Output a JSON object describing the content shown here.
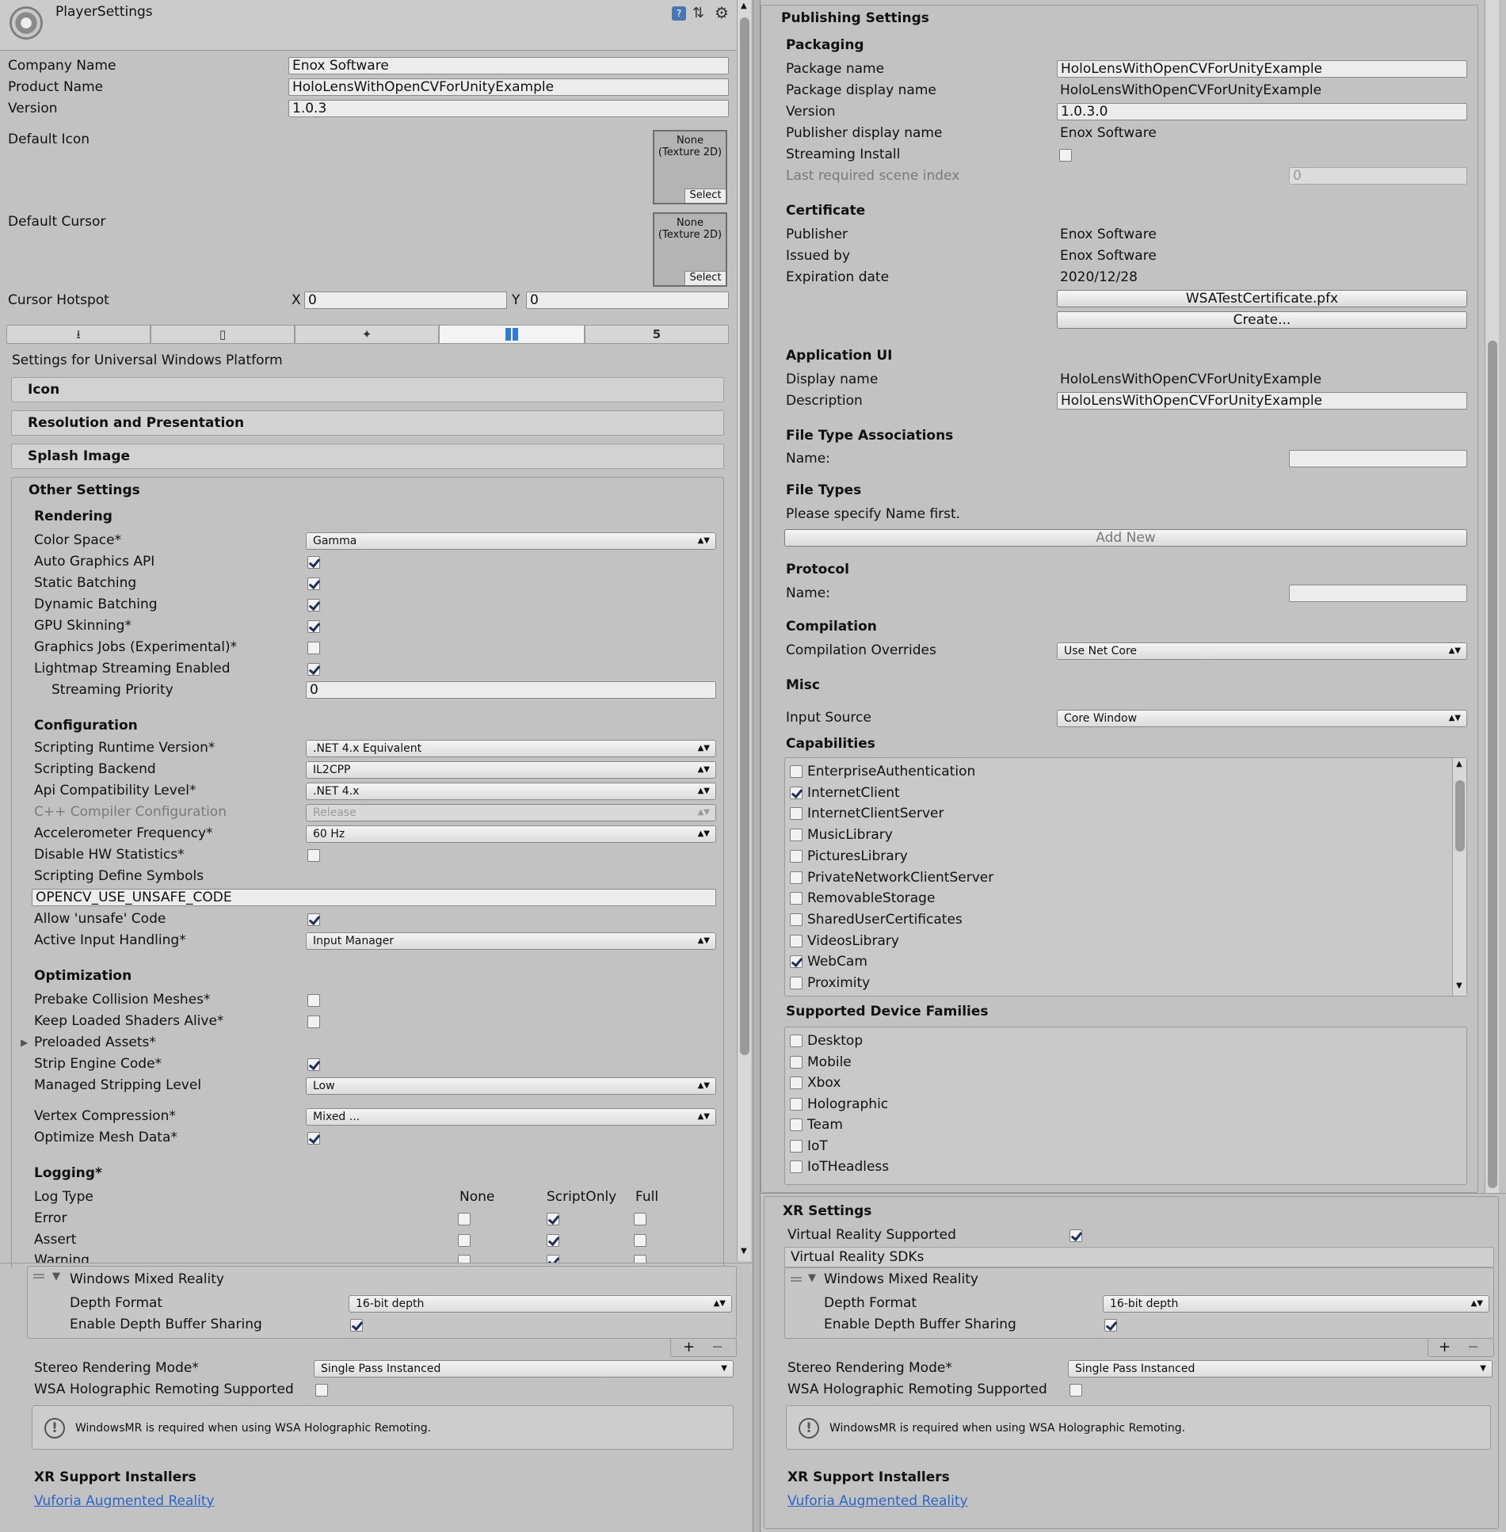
{
  "header": {
    "title": "PlayerSettings"
  },
  "top": {
    "company_label": "Company Name",
    "company_value": "Enox Software",
    "product_label": "Product Name",
    "product_value": "HoloLensWithOpenCVForUnityExample",
    "version_label": "Version",
    "version_value": "1.0.3",
    "default_icon_label": "Default Icon",
    "default_cursor_label": "Default Cursor",
    "tex_none": "None",
    "tex_type": "(Texture 2D)",
    "select_label": "Select",
    "hotspot_label": "Cursor Hotspot",
    "x_label": "X",
    "x_value": "0",
    "y_label": "Y",
    "y_value": "0"
  },
  "platform_tabs": [
    "standalone-tab",
    "ios-tab",
    "android-tab",
    "uwp-tab",
    "webgl-tab"
  ],
  "platform_title": "Settings for Universal Windows Platform",
  "foldouts": {
    "icon": "Icon",
    "resolution": "Resolution and Presentation",
    "splash": "Splash Image",
    "other": "Other Settings"
  },
  "rendering": {
    "header": "Rendering",
    "color_space_label": "Color Space*",
    "color_space_value": "Gamma",
    "auto_graphics_label": "Auto Graphics API",
    "static_batching_label": "Static Batching",
    "dynamic_batching_label": "Dynamic Batching",
    "gpu_skinning_label": "GPU Skinning*",
    "graphics_jobs_label": "Graphics Jobs (Experimental)*",
    "lightmap_streaming_label": "Lightmap Streaming Enabled",
    "streaming_priority_label": "Streaming Priority",
    "streaming_priority_value": "0"
  },
  "configuration": {
    "header": "Configuration",
    "runtime_label": "Scripting Runtime Version*",
    "runtime_value": ".NET 4.x Equivalent",
    "backend_label": "Scripting Backend",
    "backend_value": "IL2CPP",
    "api_label": "Api Compatibility Level*",
    "api_value": ".NET 4.x",
    "cpp_label": "C++ Compiler Configuration",
    "cpp_value": "Release",
    "accel_label": "Accelerometer Frequency*",
    "accel_value": "60 Hz",
    "hw_stats_label": "Disable HW Statistics*",
    "define_label": "Scripting Define Symbols",
    "define_value": "OPENCV_USE_UNSAFE_CODE",
    "unsafe_label": "Allow 'unsafe' Code",
    "input_label": "Active Input Handling*",
    "input_value": "Input Manager"
  },
  "optimization": {
    "header": "Optimization",
    "prebake_label": "Prebake Collision Meshes*",
    "keep_shaders_label": "Keep Loaded Shaders Alive*",
    "preloaded_label": "Preloaded Assets*",
    "strip_label": "Strip Engine Code*",
    "stripping_label": "Managed Stripping Level",
    "stripping_value": "Low",
    "vertex_label": "Vertex Compression*",
    "vertex_value": "Mixed ...",
    "optimize_mesh_label": "Optimize Mesh Data*"
  },
  "logging": {
    "header": "Logging*",
    "log_type": "Log Type",
    "none": "None",
    "script_only": "ScriptOnly",
    "full": "Full",
    "error": "Error",
    "assert": "Assert",
    "warning": "Warning"
  },
  "xr": {
    "header": "XR Settings",
    "vr_supported_label": "Virtual Reality Supported",
    "vr_sdks_label": "Virtual Reality SDKs",
    "wmr_label": "Windows Mixed Reality",
    "depth_format_label": "Depth Format",
    "depth_format_value": "16-bit depth",
    "depth_sharing_label": "Enable Depth Buffer Sharing",
    "plus": "+",
    "minus": "−",
    "stereo_label": "Stereo Rendering Mode*",
    "stereo_value": "Single Pass Instanced",
    "remoting_label": "WSA Holographic Remoting Supported",
    "info_text": "WindowsMR is required when using WSA Holographic Remoting.",
    "installers_header": "XR Support Installers",
    "vuforia_link": "Vuforia Augmented Reality"
  },
  "publishing": {
    "header": "Publishing Settings",
    "packaging": "Packaging",
    "package_name_label": "Package name",
    "package_name_value": "HoloLensWithOpenCVForUnityExample",
    "package_display_label": "Package display name",
    "package_display_value": "HoloLensWithOpenCVForUnityExample",
    "version_label": "Version",
    "version_value": "1.0.3.0",
    "publisher_display_label": "Publisher display name",
    "publisher_display_value": "Enox Software",
    "streaming_install_label": "Streaming Install",
    "last_scene_label": "Last required scene index",
    "last_scene_value": "0",
    "certificate": "Certificate",
    "publisher_label": "Publisher",
    "publisher_value": "Enox Software",
    "issued_label": "Issued by",
    "issued_value": "Enox Software",
    "expiration_label": "Expiration date",
    "expiration_value": "2020/12/28",
    "cert_button": "WSATestCertificate.pfx",
    "create_button": "Create...",
    "app_ui": "Application UI",
    "display_name_label": "Display name",
    "display_name_value": "HoloLensWithOpenCVForUnityExample",
    "description_label": "Description",
    "description_value": "HoloLensWithOpenCVForUnityExample",
    "fta": "File Type Associations",
    "name_label": "Name:",
    "file_types": "File Types",
    "file_types_hint": "Please specify Name first.",
    "add_new": "Add New",
    "protocol": "Protocol",
    "protocol_name_label": "Name:",
    "compilation": "Compilation",
    "overrides_label": "Compilation Overrides",
    "overrides_value": "Use Net Core",
    "misc": "Misc",
    "input_source_label": "Input Source",
    "input_source_value": "Core Window",
    "capabilities": "Capabilities",
    "capability_items": [
      {
        "label": "EnterpriseAuthentication",
        "checked": false
      },
      {
        "label": "InternetClient",
        "checked": true
      },
      {
        "label": "InternetClientServer",
        "checked": false
      },
      {
        "label": "MusicLibrary",
        "checked": false
      },
      {
        "label": "PicturesLibrary",
        "checked": false
      },
      {
        "label": "PrivateNetworkClientServer",
        "checked": false
      },
      {
        "label": "RemovableStorage",
        "checked": false
      },
      {
        "label": "SharedUserCertificates",
        "checked": false
      },
      {
        "label": "VideosLibrary",
        "checked": false
      },
      {
        "label": "WebCam",
        "checked": true
      },
      {
        "label": "Proximity",
        "checked": false
      }
    ],
    "device_families": "Supported Device Families",
    "device_items": [
      {
        "label": "Desktop",
        "checked": false
      },
      {
        "label": "Mobile",
        "checked": false
      },
      {
        "label": "Xbox",
        "checked": false
      },
      {
        "label": "Holographic",
        "checked": false
      },
      {
        "label": "Team",
        "checked": false
      },
      {
        "label": "IoT",
        "checked": false
      },
      {
        "label": "IoTHeadless",
        "checked": false
      }
    ]
  }
}
